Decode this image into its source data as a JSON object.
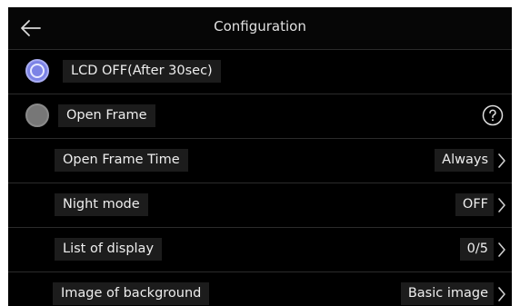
{
  "header": {
    "title": "Configuration",
    "back_icon": "arrow-left-icon"
  },
  "rows": [
    {
      "label": "LCD OFF(After 30sec)",
      "control": "radio",
      "selected": true
    },
    {
      "label": "Open Frame",
      "control": "radio",
      "selected": false,
      "trailing_icon": "help-circle-icon"
    },
    {
      "label": "Open Frame Time",
      "value": "Always",
      "trailing_icon": "chevron-right-icon"
    },
    {
      "label": "Night mode",
      "value": "OFF",
      "trailing_icon": "chevron-right-icon"
    },
    {
      "label": "List of display",
      "value": "0/5",
      "trailing_icon": "chevron-right-icon"
    },
    {
      "label": "Image of background",
      "value": "Basic image",
      "trailing_icon": "chevron-right-icon"
    }
  ],
  "colors": {
    "background": "#000000",
    "label_background": "#1c1c1c",
    "radio_selected": "#7c83e6",
    "radio_unselected": "#777777",
    "text": "#eeeeee"
  }
}
